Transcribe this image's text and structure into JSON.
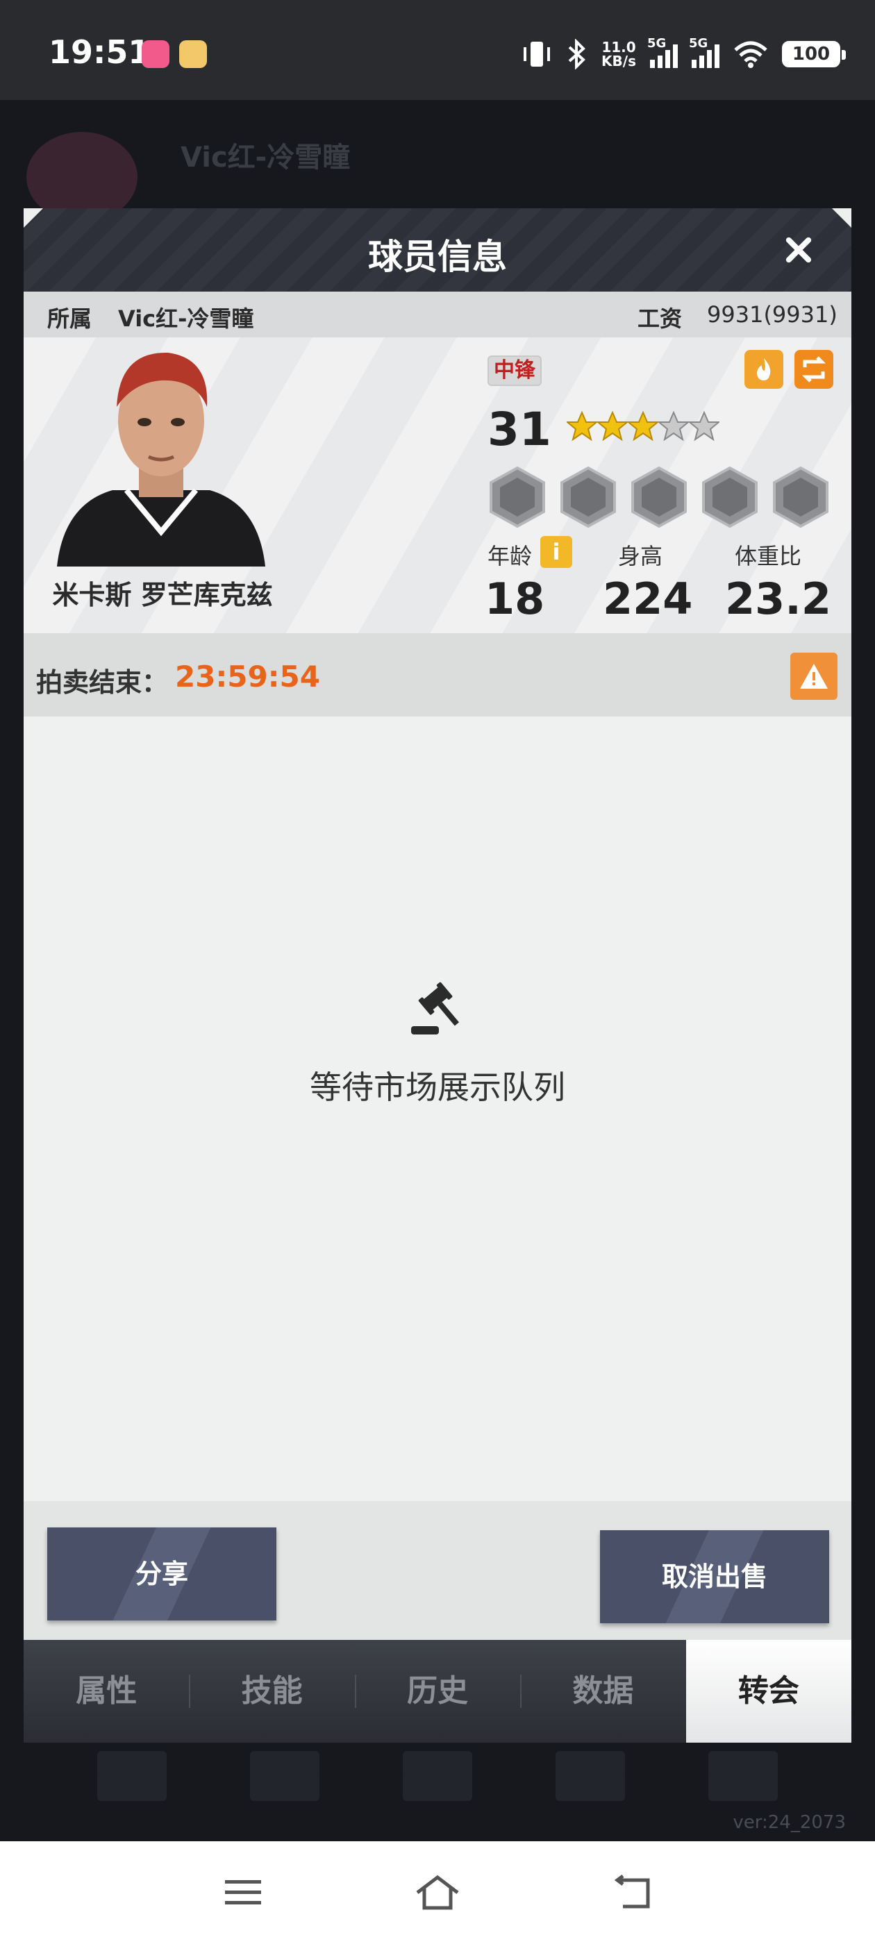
{
  "status_bar": {
    "time": "19:51",
    "net_speed_value": "11.0",
    "net_speed_unit": "KB/s",
    "signal1": "5G",
    "signal2": "5G",
    "battery": "100"
  },
  "background": {
    "team_title": "Vic红-冷雪瞳",
    "version": "ver:24_2073"
  },
  "modal": {
    "title": "球员信息",
    "team_label": "所属",
    "team_value": "Vic红-冷雪瞳",
    "salary_label": "工资",
    "salary_value": "9931(9931)",
    "player": {
      "name": "米卡斯 罗芒库克兹",
      "position": "中锋",
      "rating": "31",
      "stars_filled": 3,
      "stars_total": 5,
      "age_label": "年龄",
      "age": "18",
      "height_label": "身高",
      "height": "224",
      "weight_label": "体重比",
      "weight": "23.2",
      "info_icon": "i"
    },
    "auction": {
      "label": "拍卖结束：",
      "time": "23:59:54"
    },
    "empty_text": "等待市场展示队列",
    "share_label": "分享",
    "cancel_label": "取消出售",
    "tabs": [
      {
        "label": "属性",
        "active": false
      },
      {
        "label": "技能",
        "active": false
      },
      {
        "label": "历史",
        "active": false
      },
      {
        "label": "数据",
        "active": false
      },
      {
        "label": "转会",
        "active": true
      }
    ]
  },
  "colors": {
    "accent_orange": "#e8641a",
    "button_bg": "#4a5068",
    "position_red": "#c02020"
  }
}
